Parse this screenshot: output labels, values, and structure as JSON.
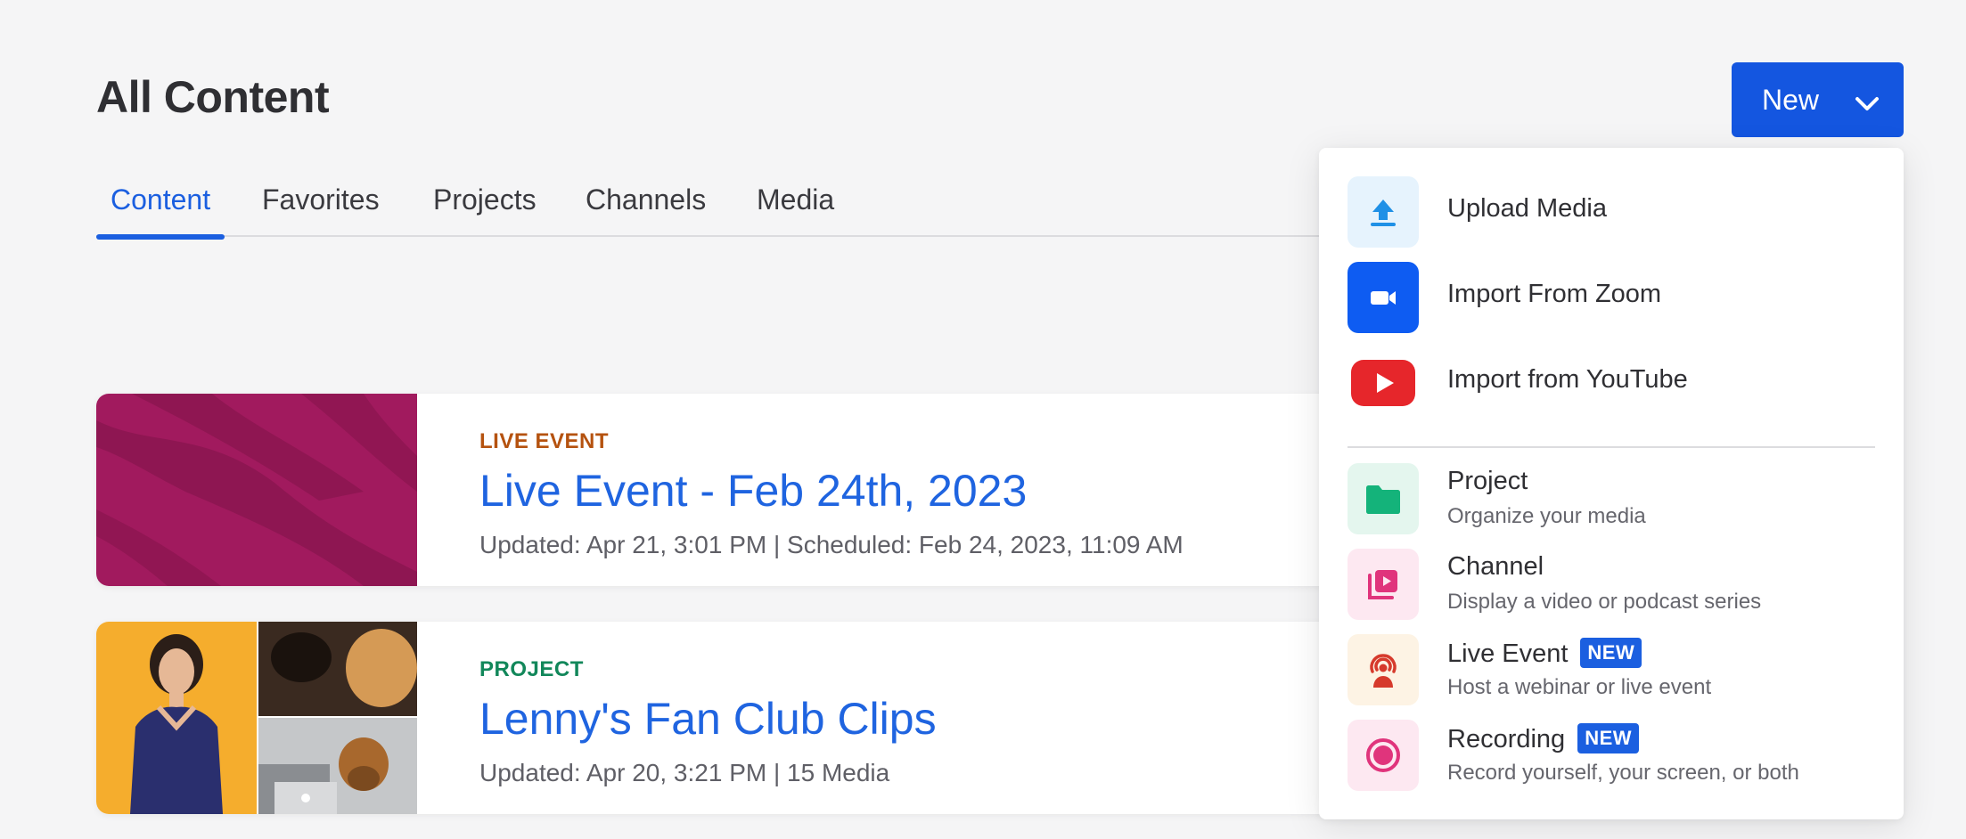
{
  "header": {
    "title": "All Content",
    "new_button_label": "New"
  },
  "tabs": [
    {
      "label": "Content",
      "active": true
    },
    {
      "label": "Favorites",
      "active": false
    },
    {
      "label": "Projects",
      "active": false
    },
    {
      "label": "Channels",
      "active": false
    },
    {
      "label": "Media",
      "active": false
    }
  ],
  "cards": [
    {
      "type": "LIVE EVENT",
      "type_color": "#b5520f",
      "title": "Live Event - Feb 24th, 2023",
      "meta": "Updated: Apr 21, 3:01 PM | Scheduled: Feb 24, 2023, 11:09 AM"
    },
    {
      "type": "PROJECT",
      "type_color": "#12875a",
      "title": "Lenny's Fan Club Clips",
      "meta": "Updated: Apr 20, 3:21 PM | 15 Media"
    }
  ],
  "new_menu": {
    "import_items": [
      {
        "label": "Upload Media",
        "icon": "upload-icon"
      },
      {
        "label": "Import From Zoom",
        "icon": "zoom-icon"
      },
      {
        "label": "Import from YouTube",
        "icon": "youtube-icon"
      }
    ],
    "create_items": [
      {
        "label": "Project",
        "sub": "Organize your media",
        "icon": "folder-icon",
        "badge": ""
      },
      {
        "label": "Channel",
        "sub": "Display a video or podcast series",
        "icon": "channel-icon",
        "badge": ""
      },
      {
        "label": "Live Event",
        "sub": "Host a webinar or live event",
        "icon": "broadcast-icon",
        "badge": "NEW"
      },
      {
        "label": "Recording",
        "sub": "Record yourself, your screen, or both",
        "icon": "record-icon",
        "badge": "NEW"
      }
    ]
  },
  "colors": {
    "accent": "#1456e0",
    "live_event_thumb": "#a11a5e"
  }
}
